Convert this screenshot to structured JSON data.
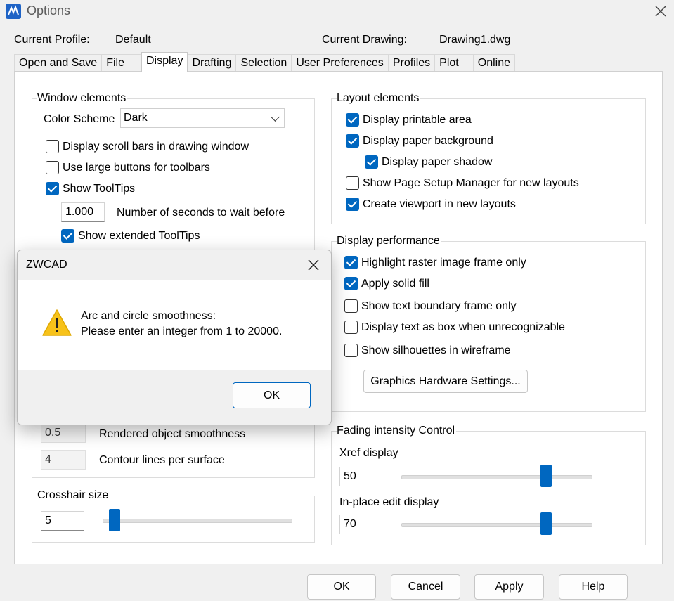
{
  "window": {
    "title": "Options"
  },
  "header": {
    "profile_label": "Current Profile:",
    "profile_value": "Default",
    "drawing_label": "Current Drawing:",
    "drawing_value": "Drawing1.dwg"
  },
  "tabs": [
    "Open and Save",
    "File",
    "Display",
    "Drafting",
    "Selection",
    "User Preferences",
    "Profiles",
    "Plot",
    "Online"
  ],
  "active_tab": "Display",
  "window_elements": {
    "title": "Window elements",
    "color_scheme_label": "Color Scheme",
    "color_scheme_value": "Dark",
    "scroll_bars": {
      "label": "Display scroll bars in drawing window",
      "checked": false
    },
    "large_buttons": {
      "label": "Use large buttons for toolbars",
      "checked": false
    },
    "show_tooltips": {
      "label": "Show ToolTips",
      "checked": true
    },
    "tooltip_seconds": {
      "value": "1.000",
      "label": "Number of seconds to wait before"
    },
    "extended_tooltips": {
      "label": "Show extended ToolTips",
      "checked": true
    },
    "rendered_smoothness": {
      "value": "0.5",
      "label": "Rendered object smoothness"
    },
    "contour_lines": {
      "value": "4",
      "label": "Contour lines per surface"
    }
  },
  "crosshair": {
    "title": "Crosshair size",
    "value": "5",
    "level_percent": 5
  },
  "layout_elements": {
    "title": "Layout elements",
    "items": [
      {
        "label": "Display printable area",
        "checked": true
      },
      {
        "label": "Display paper background",
        "checked": true
      },
      {
        "label": "Display paper shadow",
        "checked": true
      },
      {
        "label": "Show Page Setup Manager for new layouts",
        "checked": false
      },
      {
        "label": "Create viewport in new layouts",
        "checked": true
      }
    ]
  },
  "display_performance": {
    "title": "Display performance",
    "items": [
      {
        "label": "Highlight raster image frame only",
        "checked": true
      },
      {
        "label": "Apply solid fill",
        "checked": true
      },
      {
        "label": "Show text boundary frame only",
        "checked": false
      },
      {
        "label": "Display text as box when unrecognizable",
        "checked": false
      },
      {
        "label": "Show silhouettes in wireframe",
        "checked": false
      }
    ],
    "graphics_button": "Graphics Hardware Settings..."
  },
  "fading": {
    "title": "Fading intensity Control",
    "xref_label": "Xref display",
    "xref_value": "50",
    "inplace_label": "In-place edit display",
    "inplace_value": "70"
  },
  "buttons": {
    "ok": "OK",
    "cancel": "Cancel",
    "apply": "Apply",
    "help": "Help"
  },
  "dialog": {
    "title": "ZWCAD",
    "line1": "Arc and circle smoothness:",
    "line2": "Please enter an integer from 1 to 20000.",
    "ok": "OK"
  },
  "colors": {
    "accent": "#0067c0",
    "warning": "#f7c21a"
  },
  "icons": {
    "app": "zwcad-app-icon",
    "close": "close-icon",
    "warning": "warning-icon"
  }
}
